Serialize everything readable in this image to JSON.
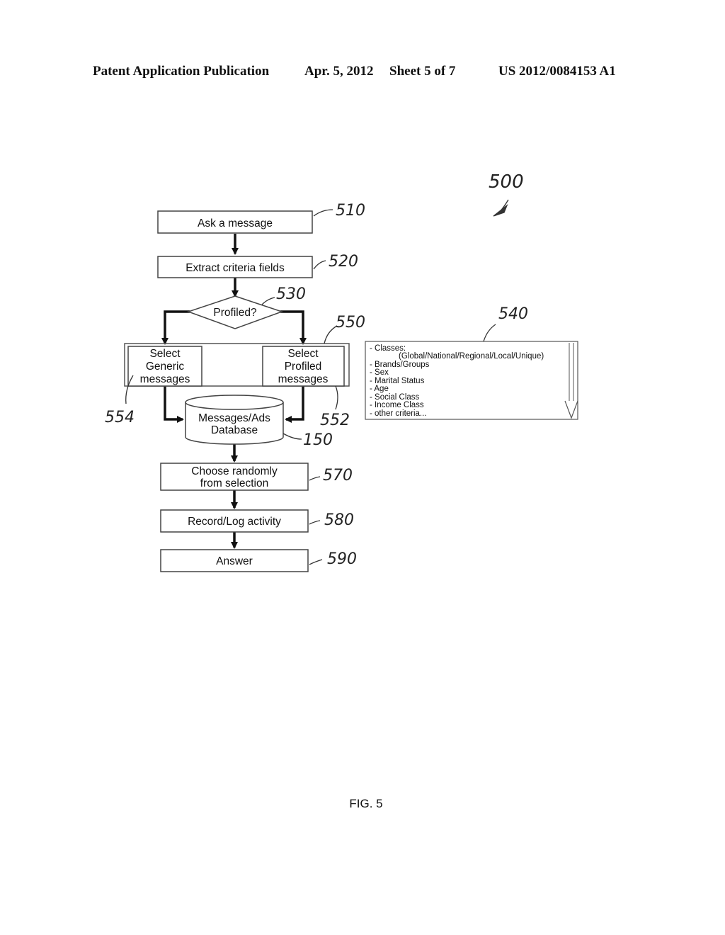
{
  "header": {
    "publication": "Patent Application Publication",
    "date": "Apr. 5, 2012",
    "sheet": "Sheet 5 of 7",
    "number": "US 2012/0084153 A1"
  },
  "figure": {
    "label": "FIG. 5",
    "ref_overall": "500"
  },
  "flowchart": {
    "nodes": [
      {
        "id": "510",
        "type": "process",
        "lines": [
          "Ask a message"
        ],
        "ref": "510"
      },
      {
        "id": "520",
        "type": "process",
        "lines": [
          "Extract criteria fields"
        ],
        "ref": "520"
      },
      {
        "id": "530",
        "type": "decision",
        "lines": [
          "Profiled?"
        ],
        "ref": "530"
      },
      {
        "id": "550",
        "type": "group",
        "lines": [],
        "ref": "550"
      },
      {
        "id": "554",
        "type": "process",
        "lines": [
          "Select",
          "Generic",
          "messages"
        ],
        "ref": "554"
      },
      {
        "id": "552",
        "type": "process",
        "lines": [
          "Select",
          "Profiled",
          "messages"
        ],
        "ref": "552"
      },
      {
        "id": "150",
        "type": "database",
        "lines": [
          "Messages/Ads",
          "Database"
        ],
        "ref": "150"
      },
      {
        "id": "570",
        "type": "process",
        "lines": [
          "Choose randomly",
          "from selection"
        ],
        "ref": "570"
      },
      {
        "id": "580",
        "type": "process",
        "lines": [
          "Record/Log activity"
        ],
        "ref": "580"
      },
      {
        "id": "590",
        "type": "process",
        "lines": [
          "Answer"
        ],
        "ref": "590"
      }
    ],
    "edges": [
      {
        "from": "510",
        "to": "520"
      },
      {
        "from": "520",
        "to": "530"
      },
      {
        "from": "530",
        "to": "554"
      },
      {
        "from": "530",
        "to": "552"
      },
      {
        "from": "554",
        "to": "150"
      },
      {
        "from": "552",
        "to": "150"
      },
      {
        "from": "150",
        "to": "570"
      },
      {
        "from": "570",
        "to": "580"
      },
      {
        "from": "580",
        "to": "590"
      }
    ]
  },
  "criteria_box": {
    "ref": "540",
    "items": [
      "- Classes:",
      "(Global/National/Regional/Local/Unique)",
      "- Brands/Groups",
      "- Sex",
      "- Marital Status",
      "- Age",
      "- Social Class",
      "- Income Class",
      "- other criteria..."
    ]
  }
}
